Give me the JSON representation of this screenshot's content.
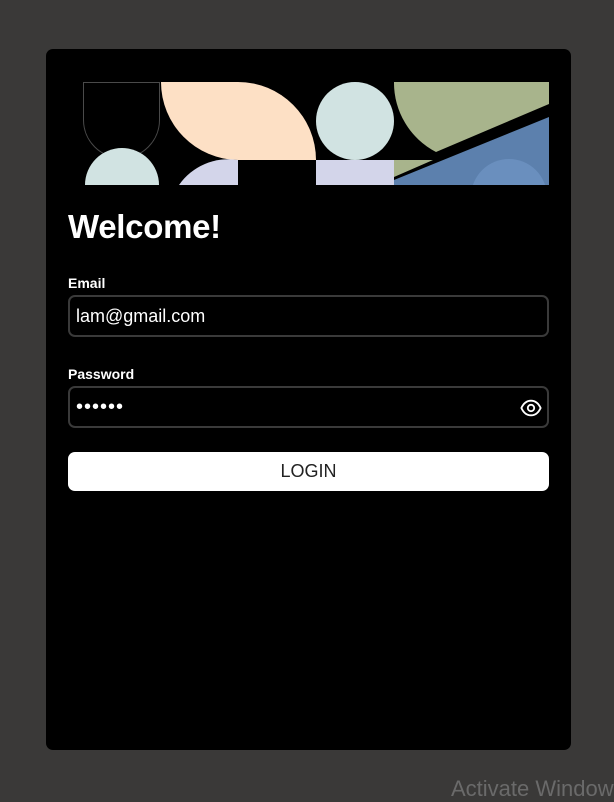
{
  "form": {
    "title": "Welcome!",
    "email_label": "Email",
    "email_value": "lam@gmail.com",
    "password_label": "Password",
    "password_value": "••••••",
    "login_label": "LOGIN"
  },
  "watermark": "Activate Windows",
  "colors": {
    "page_bg": "#3a3938",
    "card_bg": "#000000",
    "peach": "#fde0c5",
    "mint": "#d1e3e2",
    "lavender": "#d3d5ea",
    "olive": "#a8b48c",
    "steel_blue": "#5c80ad",
    "button_bg": "#ffffff"
  }
}
